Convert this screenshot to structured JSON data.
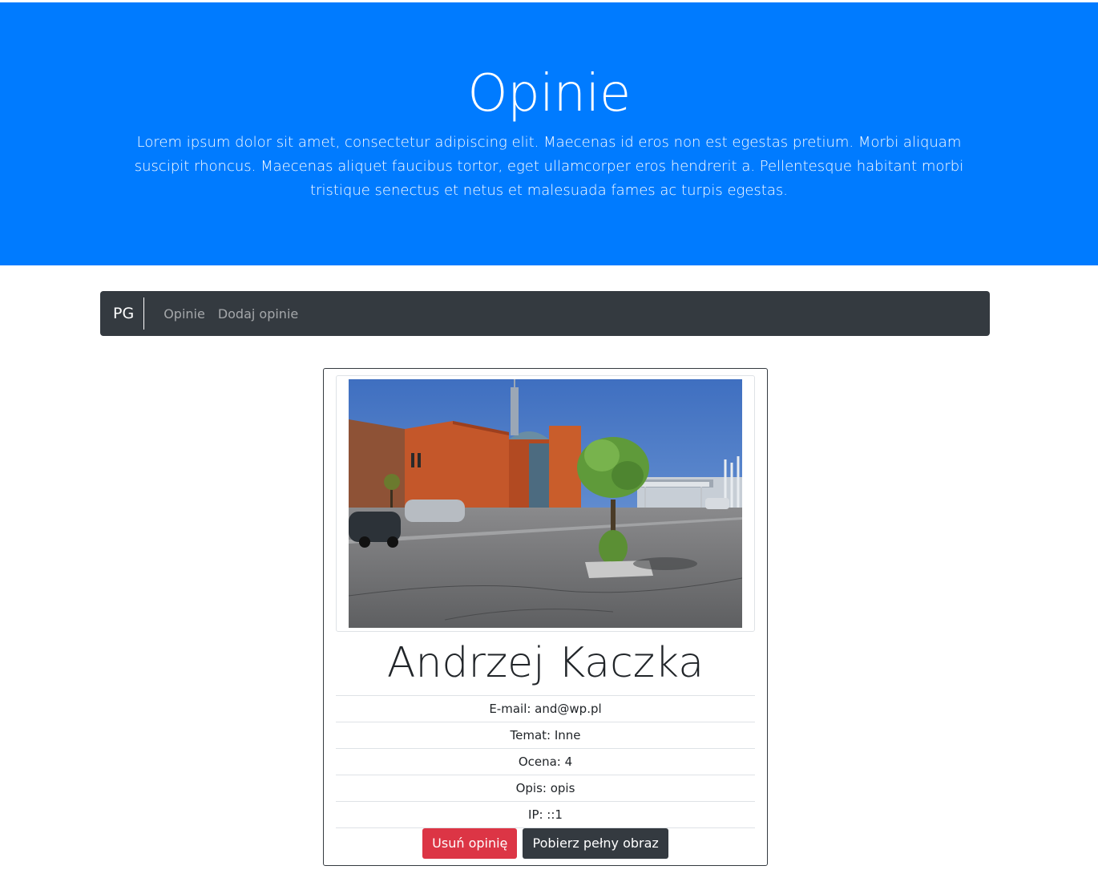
{
  "header": {
    "title": "Opinie",
    "lead": "Lorem ipsum dolor sit amet, consectetur adipiscing elit. Maecenas id eros non est egestas pretium. Morbi aliquam suscipit rhoncus. Maecenas aliquet faucibus tortor, eget ullamcorper eros hendrerit a. Pellentesque habitant morbi tristique senectus et netus et malesuada fames ac turpis egestas."
  },
  "navbar": {
    "brand": "PG",
    "links": [
      {
        "label": "Opinie"
      },
      {
        "label": "Dodaj opinie"
      }
    ]
  },
  "review": {
    "name": "Andrzej Kaczka",
    "image_alt": "Zdjęcie budynku",
    "details": [
      "E-mail: and@wp.pl",
      "Temat: Inne",
      "Ocena: 4",
      "Opis: opis",
      "IP: ::1"
    ],
    "delete_label": "Usuń opinię",
    "download_label": "Pobierz pełny obraz"
  },
  "colors": {
    "primary": "#007bff",
    "dark": "#343a40",
    "danger": "#dc3545"
  }
}
